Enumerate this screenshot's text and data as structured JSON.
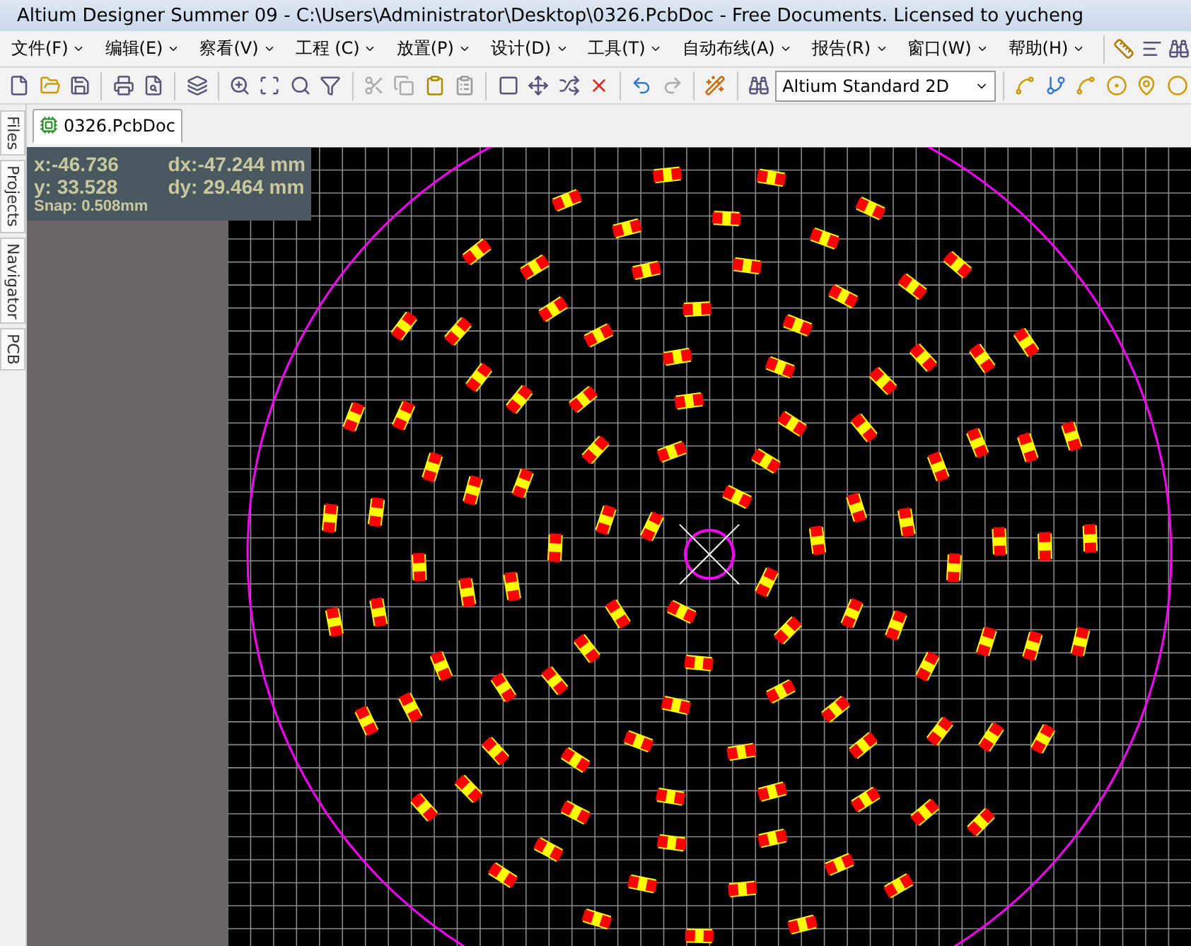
{
  "window": {
    "title": "Altium Designer Summer 09 - C:\\Users\\Administrator\\Desktop\\0326.PcbDoc - Free Documents. Licensed to yucheng"
  },
  "menu": [
    {
      "label": "文件(F)"
    },
    {
      "label": "编辑(E)"
    },
    {
      "label": "察看(V)"
    },
    {
      "label": "工程 (C)"
    },
    {
      "label": "放置(P)"
    },
    {
      "label": "设计(D)"
    },
    {
      "label": "工具(T)"
    },
    {
      "label": "自动布线(A)"
    },
    {
      "label": "报告(R)"
    },
    {
      "label": "窗口(W)"
    },
    {
      "label": "帮助(H)"
    }
  ],
  "toolbar": {
    "view_combo": {
      "value": "Altium Standard 2D"
    }
  },
  "side_tabs": [
    {
      "label": "Files"
    },
    {
      "label": "Projects"
    },
    {
      "label": "Navigator"
    },
    {
      "label": "PCB"
    }
  ],
  "document_tabs": [
    {
      "label": "0326.PcbDoc",
      "selected": true
    }
  ],
  "coordinates": {
    "x": "x:-46.736",
    "dx": "dx:-47.244 mm",
    "y": "y: 33.528",
    "dy": "dy: 29.464 mm",
    "snap": "Snap: 0.508mm"
  }
}
